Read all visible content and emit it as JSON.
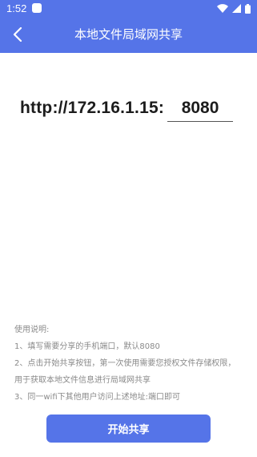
{
  "status_bar": {
    "time": "1:52",
    "icons": [
      "app-notification-icon",
      "wifi-icon",
      "signal-icon",
      "battery-icon"
    ]
  },
  "app_bar": {
    "back_icon": "chevron-left-icon",
    "title": "本地文件局域网共享"
  },
  "address": {
    "prefix": "http://172.16.1.15:",
    "port_value": "8080"
  },
  "instructions": {
    "heading": "使用说明:",
    "items": [
      "1、填写需要分享的手机端口，默认8080",
      "2、点击开始共享按钮，第一次使用需要您授权文件存储权限，用于获取本地文件信息进行局域网共享",
      "3、同一wifi下其他用户访问上述地址:端口即可"
    ]
  },
  "actions": {
    "start_label": "开始共享"
  },
  "colors": {
    "primary": "#5574e8",
    "background": "#ffffff",
    "text_dark": "#1c1c1c",
    "text_muted": "#8a8a8a"
  }
}
